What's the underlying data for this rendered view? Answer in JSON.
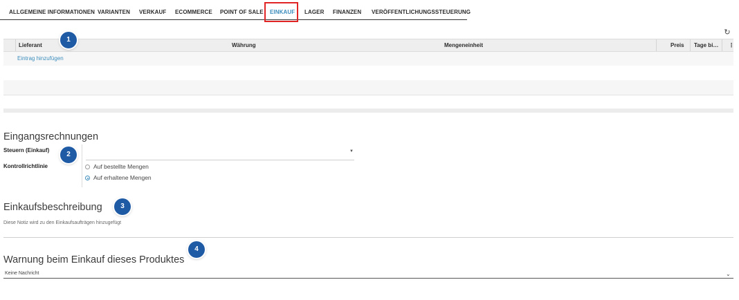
{
  "tabs": [
    {
      "label": "ALLGEMEINE INFORMATIONEN"
    },
    {
      "label": "VARIANTEN"
    },
    {
      "label": "VERKAUF"
    },
    {
      "label": "ECOMMERCE"
    },
    {
      "label": "POINT OF SALE"
    },
    {
      "label": "EINKAUF",
      "active": true
    },
    {
      "label": "LAGER"
    },
    {
      "label": "FINANZEN"
    },
    {
      "label": "VERÖFFENTLICHUNGSSTEUERUNG"
    }
  ],
  "vendor_table": {
    "columns": [
      "Lieferant",
      "Währung",
      "Mengeneinheit",
      "Preis",
      "Tage bi…"
    ],
    "add_link": "Eintrag hinzufügen"
  },
  "invoices": {
    "title": "Eingangsrechnungen",
    "taxes_label": "Steuern (Einkauf)",
    "taxes_value": "",
    "control_label": "Kontrollrichtlinie",
    "options": [
      {
        "label": "Auf bestellte Mengen",
        "selected": false
      },
      {
        "label": "Auf erhaltene Mengen",
        "selected": true
      }
    ]
  },
  "description": {
    "title": "Einkaufsbeschreibung",
    "placeholder": "Diese Notiz wird zu den Einkaufsaufträgen hinzugefügt"
  },
  "warning": {
    "title": "Warnung beim Einkauf dieses Produktes",
    "value": "Keine Nachricht"
  },
  "badges": [
    "1",
    "2",
    "3",
    "4"
  ],
  "colors": {
    "accent": "#3c8dbc",
    "highlight": "#e02424",
    "badge": "#1f5aa5"
  }
}
